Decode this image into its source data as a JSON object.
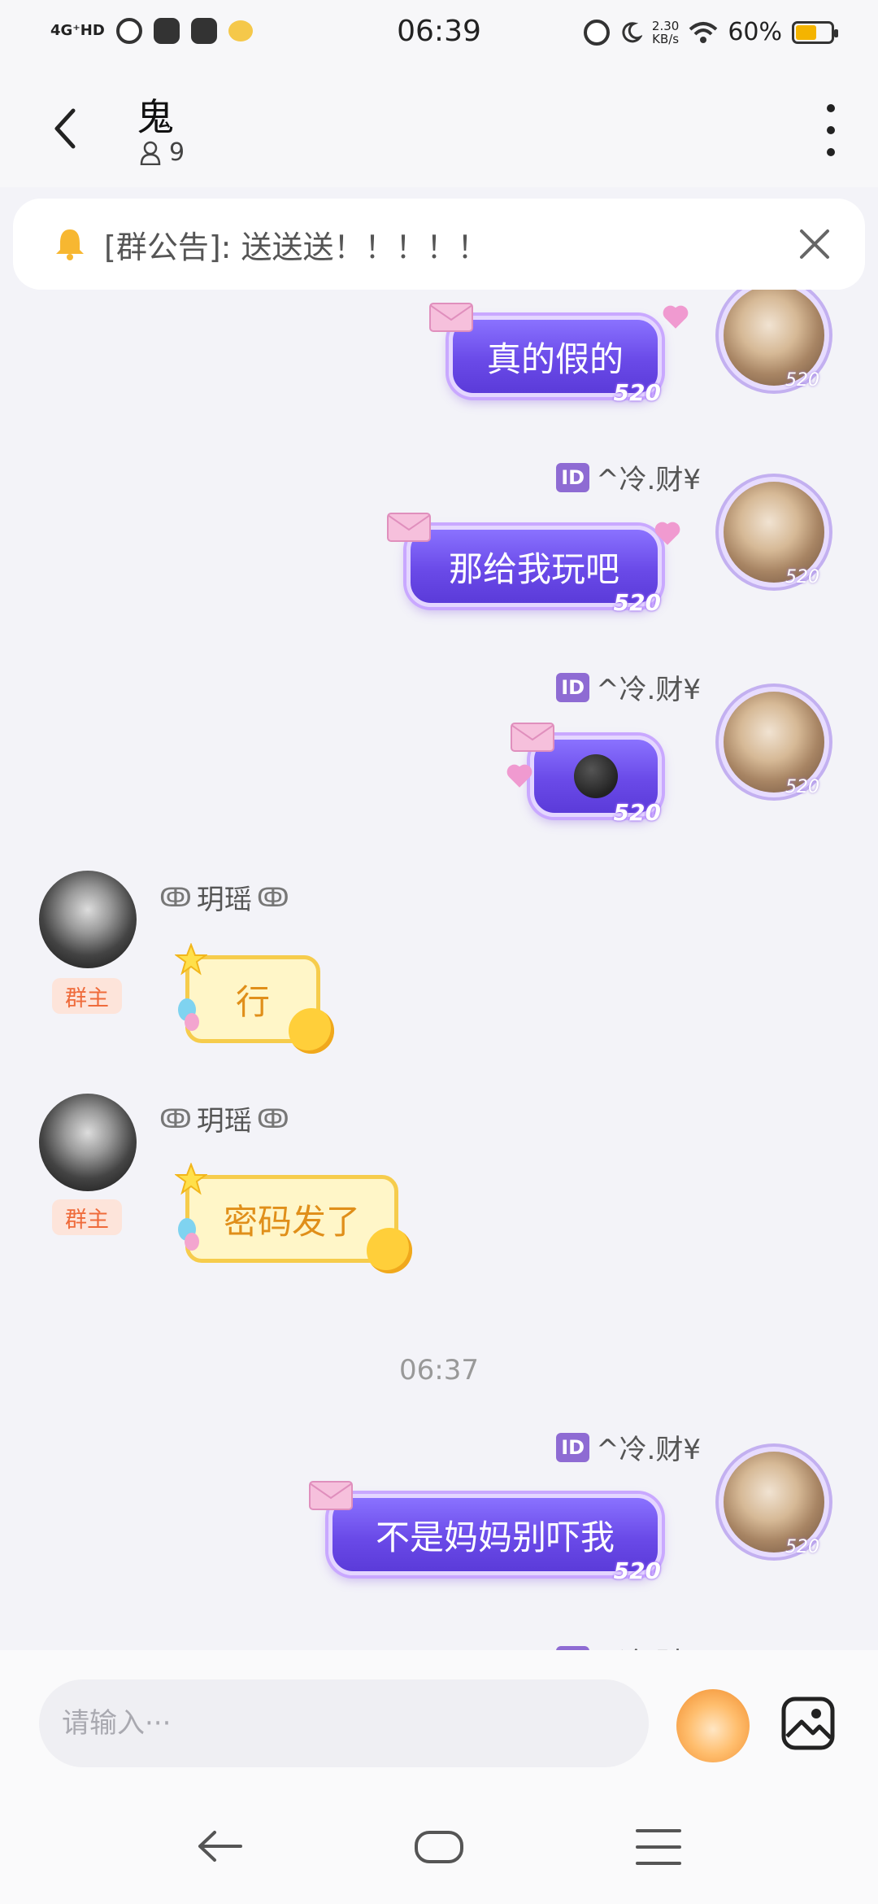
{
  "status_bar": {
    "network": "4G⁺HD",
    "time": "06:39",
    "net_speed_value": "2.30",
    "net_speed_unit": "KB/s",
    "battery_percent": "60%",
    "battery_level": 0.6
  },
  "header": {
    "title": "鬼",
    "member_count": "9"
  },
  "notice": {
    "text": "[群公告]: 送送送！！！！！"
  },
  "chat": {
    "sender_me": "^冷.财¥",
    "id_badge": "ID",
    "tag_520": "520",
    "owner_name": "玥瑶",
    "owner_badge": "群主",
    "messages": [
      {
        "from": "me",
        "text": "真的假的"
      },
      {
        "from": "me",
        "text": "那给我玩吧"
      },
      {
        "from": "me",
        "emoji": "dark-moon-face"
      },
      {
        "from": "owner",
        "text": "行"
      },
      {
        "from": "owner",
        "text": "密码发了"
      },
      {
        "from": "me",
        "text": "不是妈妈别吓我"
      }
    ],
    "timestamp": "06:37"
  },
  "input": {
    "placeholder": "请输入···"
  },
  "icons": {
    "bell": "bell-icon",
    "close": "close-icon",
    "back": "chevron-left-icon",
    "more": "more-vertical-icon",
    "image": "image-icon",
    "mascot": "mascot-sticker-icon"
  },
  "colors": {
    "my_bubble": "#6a4ae8",
    "owner_bubble": "#fff6c8",
    "owner_badge_text": "#ef6b3b",
    "battery": "#f4b400"
  }
}
